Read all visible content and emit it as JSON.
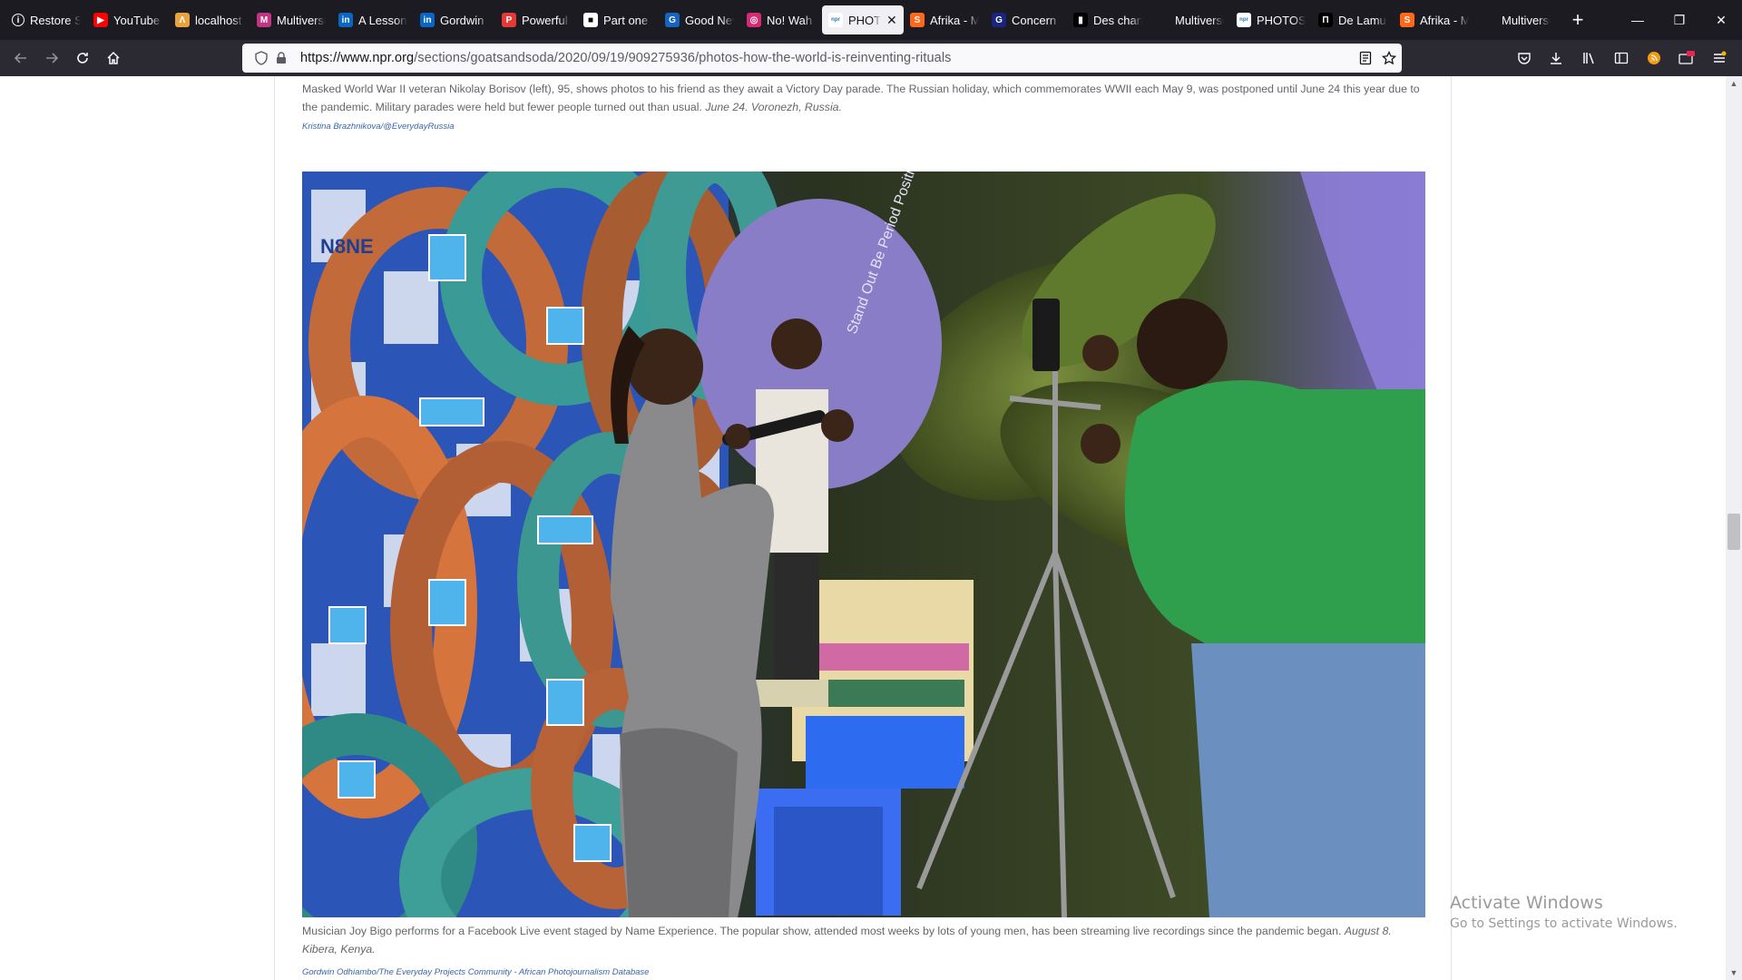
{
  "browser": {
    "tabs": [
      {
        "label": "Restore Session",
        "favicon": "info-icon",
        "color": "#fbfbfe",
        "glyph": "i"
      },
      {
        "label": "YouTube",
        "favicon": "youtube-icon",
        "color": "#ff0000",
        "glyph": "▶"
      },
      {
        "label": "localhost",
        "favicon": "localhost-icon",
        "color": "#e8a33d",
        "glyph": "Λ"
      },
      {
        "label": "Multiverse",
        "favicon": "multiverse-icon",
        "color": "#c13584",
        "glyph": "M"
      },
      {
        "label": "A Lesson",
        "favicon": "linkedin-icon",
        "color": "#0a66c2",
        "glyph": "in"
      },
      {
        "label": "Gordwin",
        "favicon": "linkedin-icon",
        "color": "#0a66c2",
        "glyph": "in"
      },
      {
        "label": "Powerful",
        "favicon": "powerful-icon",
        "color": "#e53935",
        "glyph": "P"
      },
      {
        "label": "Part one",
        "favicon": "page-icon",
        "color": "#ffffff",
        "glyph": "■"
      },
      {
        "label": "Good News",
        "favicon": "goodnews-icon",
        "color": "#1565c0",
        "glyph": "G"
      },
      {
        "label": "No! Wah",
        "favicon": "instagram-icon",
        "color": "#d62976",
        "glyph": "◎"
      },
      {
        "label": "PHOTOS",
        "favicon": "npr-icon",
        "color": "#237bbd",
        "glyph": "npr",
        "active": true
      },
      {
        "label": "Afrika - M",
        "favicon": "substack-icon",
        "color": "#ff6719",
        "glyph": "S"
      },
      {
        "label": "Concern",
        "favicon": "concern-icon",
        "color": "#1a237e",
        "glyph": "G"
      },
      {
        "label": "Des chan",
        "favicon": "medium-icon",
        "color": "#000000",
        "glyph": "▮"
      },
      {
        "label": "Multiverse b",
        "favicon": "blank-icon",
        "color": "transparent",
        "glyph": ""
      },
      {
        "label": "PHOTOS",
        "favicon": "npr-icon",
        "color": "#237bbd",
        "glyph": "npr"
      },
      {
        "label": "De Lamu",
        "favicon": "dl-icon",
        "color": "#000000",
        "glyph": "Π"
      },
      {
        "label": "Afrika - M",
        "favicon": "substack-icon",
        "color": "#ff6719",
        "glyph": "S"
      },
      {
        "label": "Multiverse b",
        "favicon": "blank-icon",
        "color": "transparent",
        "glyph": ""
      }
    ],
    "new_tab": "+",
    "minimize": "—",
    "restore": "❐",
    "close": "✕",
    "url_domain": "https://www.npr.org",
    "url_path": "/sections/goatsandsoda/2020/09/19/909275936/photos-how-the-world-is-reinventing-rituals"
  },
  "article": {
    "caption1_text": "Masked World War II veteran Nikolay Borisov (left), 95, shows photos to his friend as they await a Victory Day parade. The Russian holiday, which commemorates WWII each May 9, was postponed until June 24 this year due to the pandemic. Military parades were held but fewer people turned out than usual.",
    "caption1_place": "June 24. Voronezh, Russia.",
    "credit1": "Kristina Brazhnikova/@EverydayRussia",
    "caption2_text": "Musician Joy Bigo performs for a Facebook Live event staged by Name Experience. The popular show, attended most weeks by lots of young men, has been streaming live recordings since the pandemic began.",
    "caption2_place": "August 8. Kibera, Kenya.",
    "credit2": "Gordwin Odhiambo/The Everyday Projects Community - African Photojournalism Database",
    "photo_backdrop_text": "Stand Out Be Period Positive",
    "photo_brand": "N8NE"
  },
  "os": {
    "watermark_line1": "Activate Windows",
    "watermark_line2": "Go to Settings to activate Windows."
  }
}
